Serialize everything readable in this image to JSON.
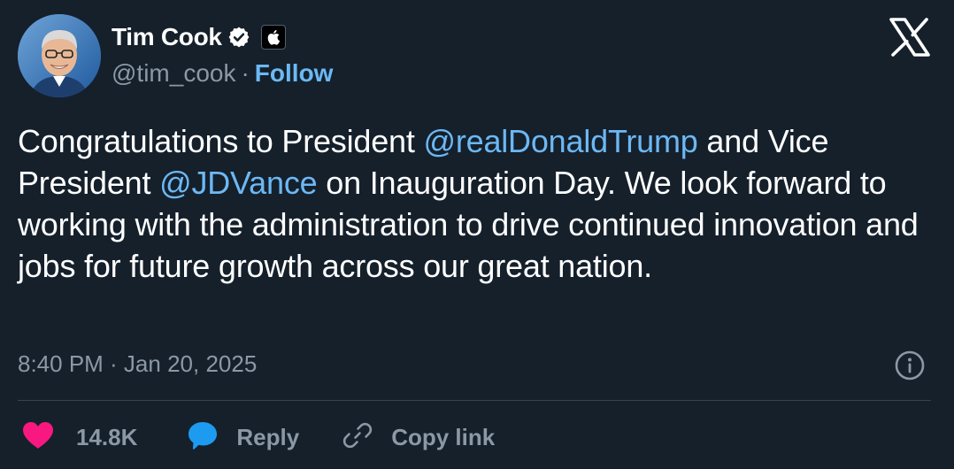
{
  "author": {
    "display_name": "Tim Cook",
    "handle": "@tim_cook",
    "separator": "·",
    "follow_label": "Follow",
    "verified_icon": "verified-badge-icon",
    "affiliation_icon": "apple-logo-icon"
  },
  "tweet": {
    "segments": [
      {
        "text": "Congratulations to President ",
        "type": "text"
      },
      {
        "text": "@realDonaldTrump",
        "type": "mention"
      },
      {
        "text": " and Vice President ",
        "type": "text"
      },
      {
        "text": "@JDVance",
        "type": "mention"
      },
      {
        "text": " on Inauguration Day. We look forward to working with the administration to drive continued innovation and jobs for future growth across our great nation.",
        "type": "text"
      }
    ],
    "timestamp": "8:40 PM · Jan 20, 2025"
  },
  "actions": {
    "like_count": "14.8K",
    "reply_label": "Reply",
    "copy_link_label": "Copy link"
  },
  "colors": {
    "background": "#15202b",
    "accent": "#6cb8f5",
    "muted": "#8b98a5",
    "like": "#f91880",
    "reply": "#1d9bf0"
  }
}
